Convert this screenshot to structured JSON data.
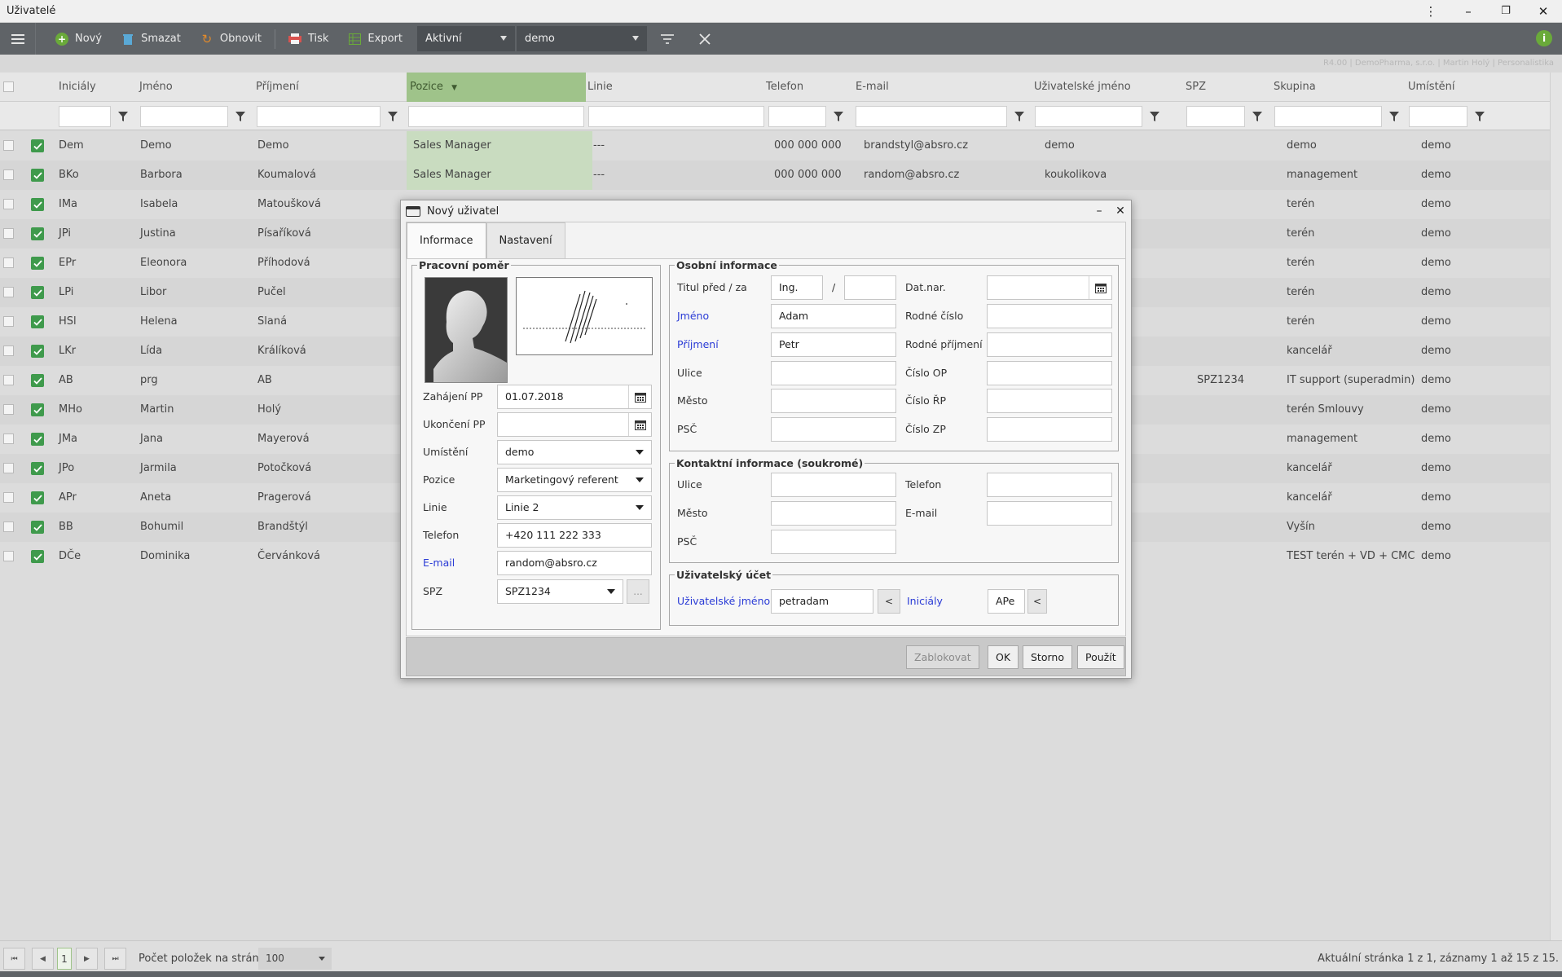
{
  "window": {
    "title": "Uživatelé",
    "controls": {
      "more": "⋮",
      "minimize": "–",
      "restore": "❐",
      "close": "✕"
    }
  },
  "toolbar": {
    "new_label": "Nový",
    "delete_label": "Smazat",
    "refresh_label": "Obnovit",
    "print_label": "Tisk",
    "export_label": "Export",
    "status_filter": "Aktivní",
    "location_filter": "demo",
    "info": "i"
  },
  "info_strip": "R4.00 | DemoPharma, s.r.o. | Martin Holý | Personalistika",
  "grid": {
    "columns": [
      "Iniciály",
      "Jméno",
      "Příjmení",
      "Pozice",
      "Linie",
      "Telefon",
      "E-mail",
      "Uživatelské jméno",
      "SPZ",
      "Skupina",
      "Umístění"
    ],
    "sort_indicator": "▼",
    "rows": [
      {
        "ini": "Dem",
        "first": "Demo",
        "last": "Demo",
        "pos": "Sales Manager",
        "line": "---",
        "phone": "000 000 000",
        "email": "brandstyl@absro.cz",
        "user": "demo",
        "spz": "",
        "group": "demo",
        "loc": "demo"
      },
      {
        "ini": "BKo",
        "first": "Barbora",
        "last": "Koumalová",
        "pos": "Sales Manager",
        "line": "---",
        "phone": "000 000 000",
        "email": "random@absro.cz",
        "user": "koukolikova",
        "spz": "",
        "group": "management",
        "loc": "demo"
      },
      {
        "ini": "IMa",
        "first": "Isabela",
        "last": "Matoušková",
        "pos": "",
        "line": "",
        "phone": "",
        "email": "",
        "user": "",
        "spz": "",
        "group": "terén",
        "loc": "demo"
      },
      {
        "ini": "JPi",
        "first": "Justina",
        "last": "Písaříková",
        "pos": "",
        "line": "",
        "phone": "",
        "email": "",
        "user": "",
        "spz": "",
        "group": "terén",
        "loc": "demo"
      },
      {
        "ini": "EPr",
        "first": "Eleonora",
        "last": "Příhodová",
        "pos": "",
        "line": "",
        "phone": "",
        "email": "",
        "user": "",
        "spz": "",
        "group": "terén",
        "loc": "demo"
      },
      {
        "ini": "LPi",
        "first": "Libor",
        "last": "Pučel",
        "pos": "",
        "line": "",
        "phone": "",
        "email": "",
        "user": "",
        "spz": "",
        "group": "terén",
        "loc": "demo"
      },
      {
        "ini": "HSl",
        "first": "Helena",
        "last": "Slaná",
        "pos": "",
        "line": "",
        "phone": "",
        "email": "",
        "user": "",
        "spz": "",
        "group": "terén",
        "loc": "demo"
      },
      {
        "ini": "LKr",
        "first": "Lída",
        "last": "Králíková",
        "pos": "",
        "line": "",
        "phone": "",
        "email": "",
        "user": "",
        "spz": "",
        "group": "kancelář",
        "loc": "demo"
      },
      {
        "ini": "AB",
        "first": "prg",
        "last": "AB",
        "pos": "",
        "line": "",
        "phone": "",
        "email": "",
        "user": "",
        "spz": "SPZ1234",
        "group": "IT support (superadmin)",
        "loc": "demo"
      },
      {
        "ini": "MHo",
        "first": "Martin",
        "last": "Holý",
        "pos": "",
        "line": "",
        "phone": "",
        "email": "",
        "user": "",
        "spz": "",
        "group": "terén Smlouvy",
        "loc": "demo"
      },
      {
        "ini": "JMa",
        "first": "Jana",
        "last": "Mayerová",
        "pos": "",
        "line": "",
        "phone": "",
        "email": "",
        "user": "",
        "spz": "",
        "group": "management",
        "loc": "demo"
      },
      {
        "ini": "JPo",
        "first": "Jarmila",
        "last": "Potočková",
        "pos": "",
        "line": "",
        "phone": "",
        "email": "",
        "user": "",
        "spz": "",
        "group": "kancelář",
        "loc": "demo"
      },
      {
        "ini": "APr",
        "first": "Aneta",
        "last": "Pragerová",
        "pos": "",
        "line": "",
        "phone": "",
        "email": "",
        "user": "",
        "spz": "",
        "group": "kancelář",
        "loc": "demo"
      },
      {
        "ini": "BB",
        "first": "Bohumil",
        "last": "Brandštýl",
        "pos": "",
        "line": "",
        "phone": "",
        "email": "",
        "user": "",
        "spz": "",
        "group": "Vyšín",
        "loc": "demo"
      },
      {
        "ini": "DČe",
        "first": "Dominika",
        "last": "Červánková",
        "pos": "",
        "line": "",
        "phone": "",
        "email": "",
        "user": "",
        "spz": "",
        "group": "TEST terén + VD + CMC",
        "loc": "demo"
      }
    ]
  },
  "pager": {
    "current_page": "1",
    "per_page_label": "Počet položek na stránku:",
    "per_page_value": "100",
    "status": "Aktuální stránka 1 z 1, záznamy 1 až 15 z 15."
  },
  "dialog": {
    "title": "Nový uživatel",
    "tabs": [
      "Informace",
      "Nastavení"
    ],
    "employment": {
      "legend": "Pracovní poměr",
      "start_label": "Zahájení PP",
      "start_value": "01.07.2018",
      "end_label": "Ukončení PP",
      "end_value": "",
      "location_label": "Umístění",
      "location_value": "demo",
      "position_label": "Pozice",
      "position_value": "Marketingový referent",
      "line_label": "Linie",
      "line_value": "Linie 2",
      "phone_label": "Telefon",
      "phone_value": "+420 111 222 333",
      "email_label": "E-mail",
      "email_value": "random@absro.cz",
      "spz_label": "SPZ",
      "spz_value": "SPZ1234",
      "more_btn": "..."
    },
    "personal": {
      "legend": "Osobní informace",
      "title_label": "Titul před / za",
      "title_before": "Ing.",
      "title_sep": "/",
      "title_after": "",
      "first_label": "Jméno",
      "first_value": "Adam",
      "last_label": "Příjmení",
      "last_value": "Petr",
      "street_label": "Ulice",
      "street_value": "",
      "city_label": "Město",
      "city_value": "",
      "zip_label": "PSČ",
      "zip_value": "",
      "birth_label": "Dat.nar.",
      "birth_value": "",
      "birthnum_label": "Rodné číslo",
      "birthnum_value": "",
      "maiden_label": "Rodné příjmení",
      "maiden_value": "",
      "op_label": "Číslo OP",
      "op_value": "",
      "rp_label": "Číslo ŘP",
      "rp_value": "",
      "zp_label": "Číslo ZP",
      "zp_value": ""
    },
    "contact": {
      "legend": "Kontaktní informace (soukromé)",
      "street_label": "Ulice",
      "street_value": "",
      "city_label": "Město",
      "city_value": "",
      "zip_label": "PSČ",
      "zip_value": "",
      "phone_label": "Telefon",
      "phone_value": "",
      "email_label": "E-mail",
      "email_value": ""
    },
    "account": {
      "legend": "Uživatelský účet",
      "username_label": "Uživatelské jméno",
      "username_value": "petradam",
      "initials_label": "Iniciály",
      "initials_value": "APe",
      "arrow": "<"
    },
    "buttons": {
      "block": "Zablokovat",
      "ok": "OK",
      "cancel": "Storno",
      "apply": "Použít"
    },
    "min": "–",
    "close": "✕"
  },
  "colors": {
    "toolbar": "#5f6367",
    "accent_green": "#3f9a4c",
    "sorted_column": "#9fc38a",
    "link_blue": "#2a3bd6"
  }
}
